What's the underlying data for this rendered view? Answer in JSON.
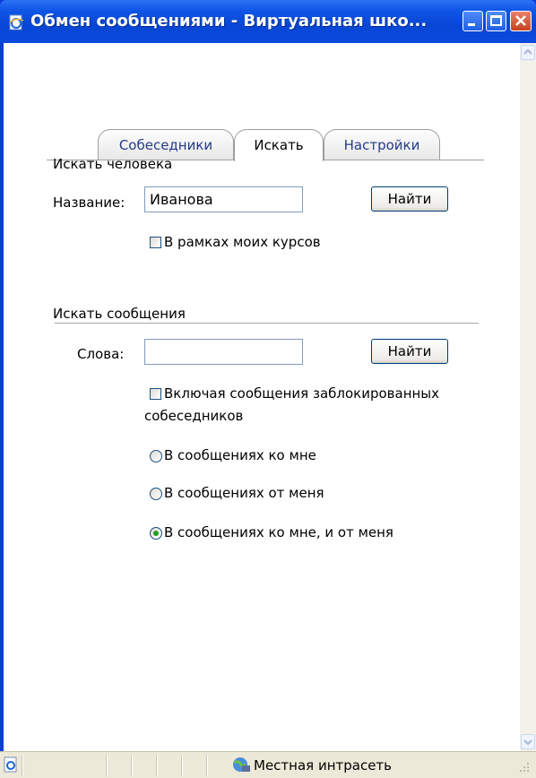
{
  "window": {
    "title": "Обмен сообщениями - Виртуальная шко..."
  },
  "tabs": [
    {
      "label": "Собеседники"
    },
    {
      "label": "Искать"
    },
    {
      "label": "Настройки"
    }
  ],
  "people_search": {
    "heading": "Искать человека",
    "name_label": "Название:",
    "name_value": "Иванова",
    "find_label": "Найти",
    "my_courses_label": "В рамках моих курсов"
  },
  "message_search": {
    "heading": "Искать сообщения",
    "words_label": "Слова:",
    "words_value": "",
    "find_label": "Найти",
    "blocked_label_line1": "Включая сообщения заблокированных",
    "blocked_label_line2": "собеседников",
    "radio_to_me": "В сообщениях ко мне",
    "radio_from_me": "В сообщениях от меня",
    "radio_both": "В сообщениях ко мне, и от меня",
    "selected_radio": "both"
  },
  "statusbar": {
    "zone": "Местная интрасеть"
  },
  "colors": {
    "titlebar": "#0846d4",
    "tab_text": "#243a8a",
    "radio_selected": "#21a121"
  }
}
